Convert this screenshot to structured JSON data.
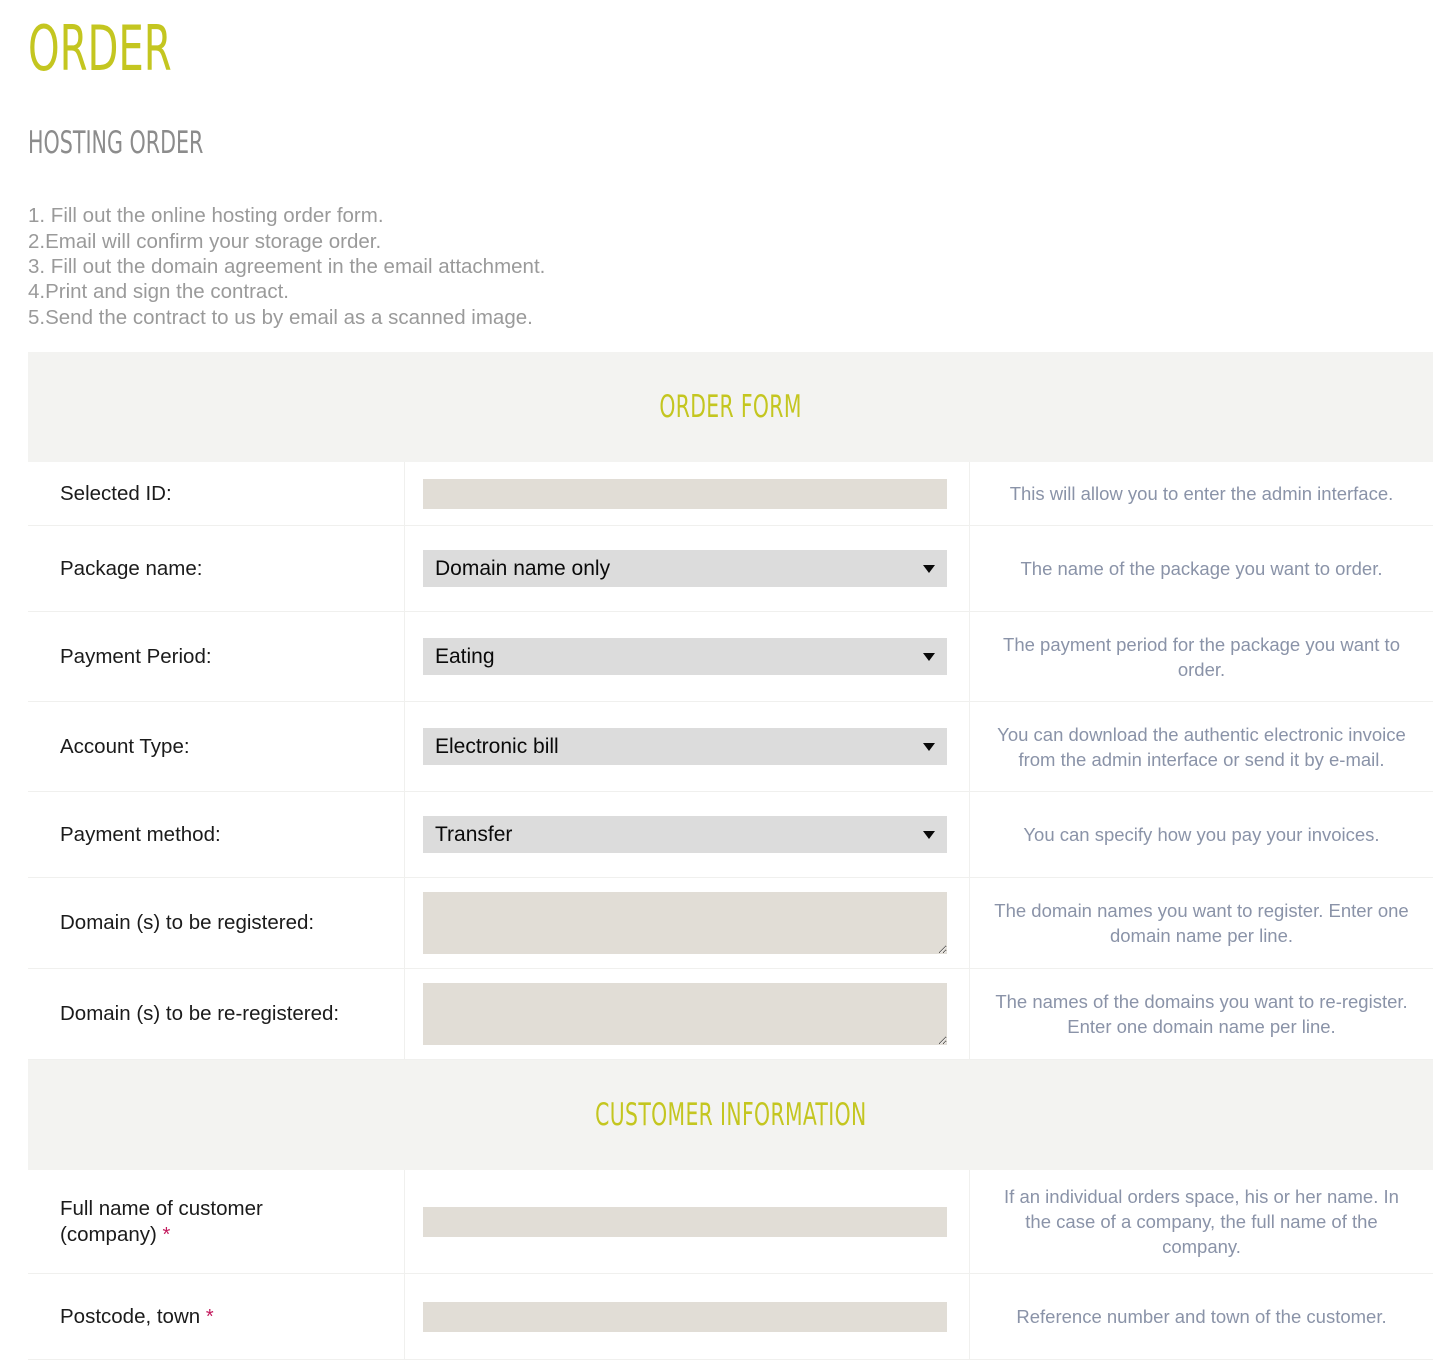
{
  "page": {
    "title": "ORDER",
    "subtitle": "HOSTING ORDER",
    "steps": [
      "1. Fill out the online hosting order form.",
      "2.Email will confirm your storage order.",
      "3. Fill out the domain agreement in the email attachment.",
      "4.Print and sign the contract.",
      "5.Send the contract to us by email as a scanned image."
    ]
  },
  "colors": {
    "accent": "#c4c620",
    "help_text": "#8a93a8",
    "required": "#c2195c",
    "band_bg": "#f3f3f1",
    "input_bg": "#e1ddd6",
    "select_bg": "#dcdcdc"
  },
  "order_form": {
    "heading": "ORDER FORM",
    "rows": [
      {
        "label": "Selected ID:",
        "required": false,
        "control": "text",
        "value": "",
        "placeholder": "",
        "help": "This will allow you to enter the admin interface."
      },
      {
        "label": "Package name:",
        "required": false,
        "control": "select",
        "value": "Domain name only",
        "options": [
          "Domain name only"
        ],
        "help": "The name of the package you want to order."
      },
      {
        "label": "Payment Period:",
        "required": false,
        "control": "select",
        "value": "Eating",
        "options": [
          "Eating"
        ],
        "help": "The payment period for the package you want to order."
      },
      {
        "label": "Account Type:",
        "required": false,
        "control": "select",
        "value": "Electronic bill",
        "options": [
          "Electronic bill"
        ],
        "help": "You can download the authentic electronic invoice from the admin interface or send it by e-mail."
      },
      {
        "label": "Payment method:",
        "required": false,
        "control": "select",
        "value": "Transfer",
        "options": [
          "Transfer"
        ],
        "help": "You can specify how you pay your invoices."
      },
      {
        "label": "Domain (s) to be registered:",
        "required": false,
        "control": "textarea",
        "value": "",
        "placeholder": "",
        "help": "The domain names you want to register. Enter one domain name per line."
      },
      {
        "label": "Domain (s) to be re-registered:",
        "required": false,
        "control": "textarea",
        "value": "",
        "placeholder": "",
        "help": "The names of the domains you want to re-register. Enter one domain name per line."
      }
    ]
  },
  "customer_information": {
    "heading": "CUSTOMER INFORMATION",
    "required_marker": "*",
    "rows": [
      {
        "label_line1": "Full name of customer",
        "label_line2": "(company)",
        "required": true,
        "control": "text",
        "value": "",
        "placeholder": "",
        "help": "If an individual orders space, his or her name. In the case of a company, the full name of the company."
      },
      {
        "label_line1": "Postcode, town",
        "label_line2": "",
        "required": true,
        "control": "text",
        "value": "",
        "placeholder": "",
        "help": "Reference number and town of the customer."
      }
    ]
  }
}
